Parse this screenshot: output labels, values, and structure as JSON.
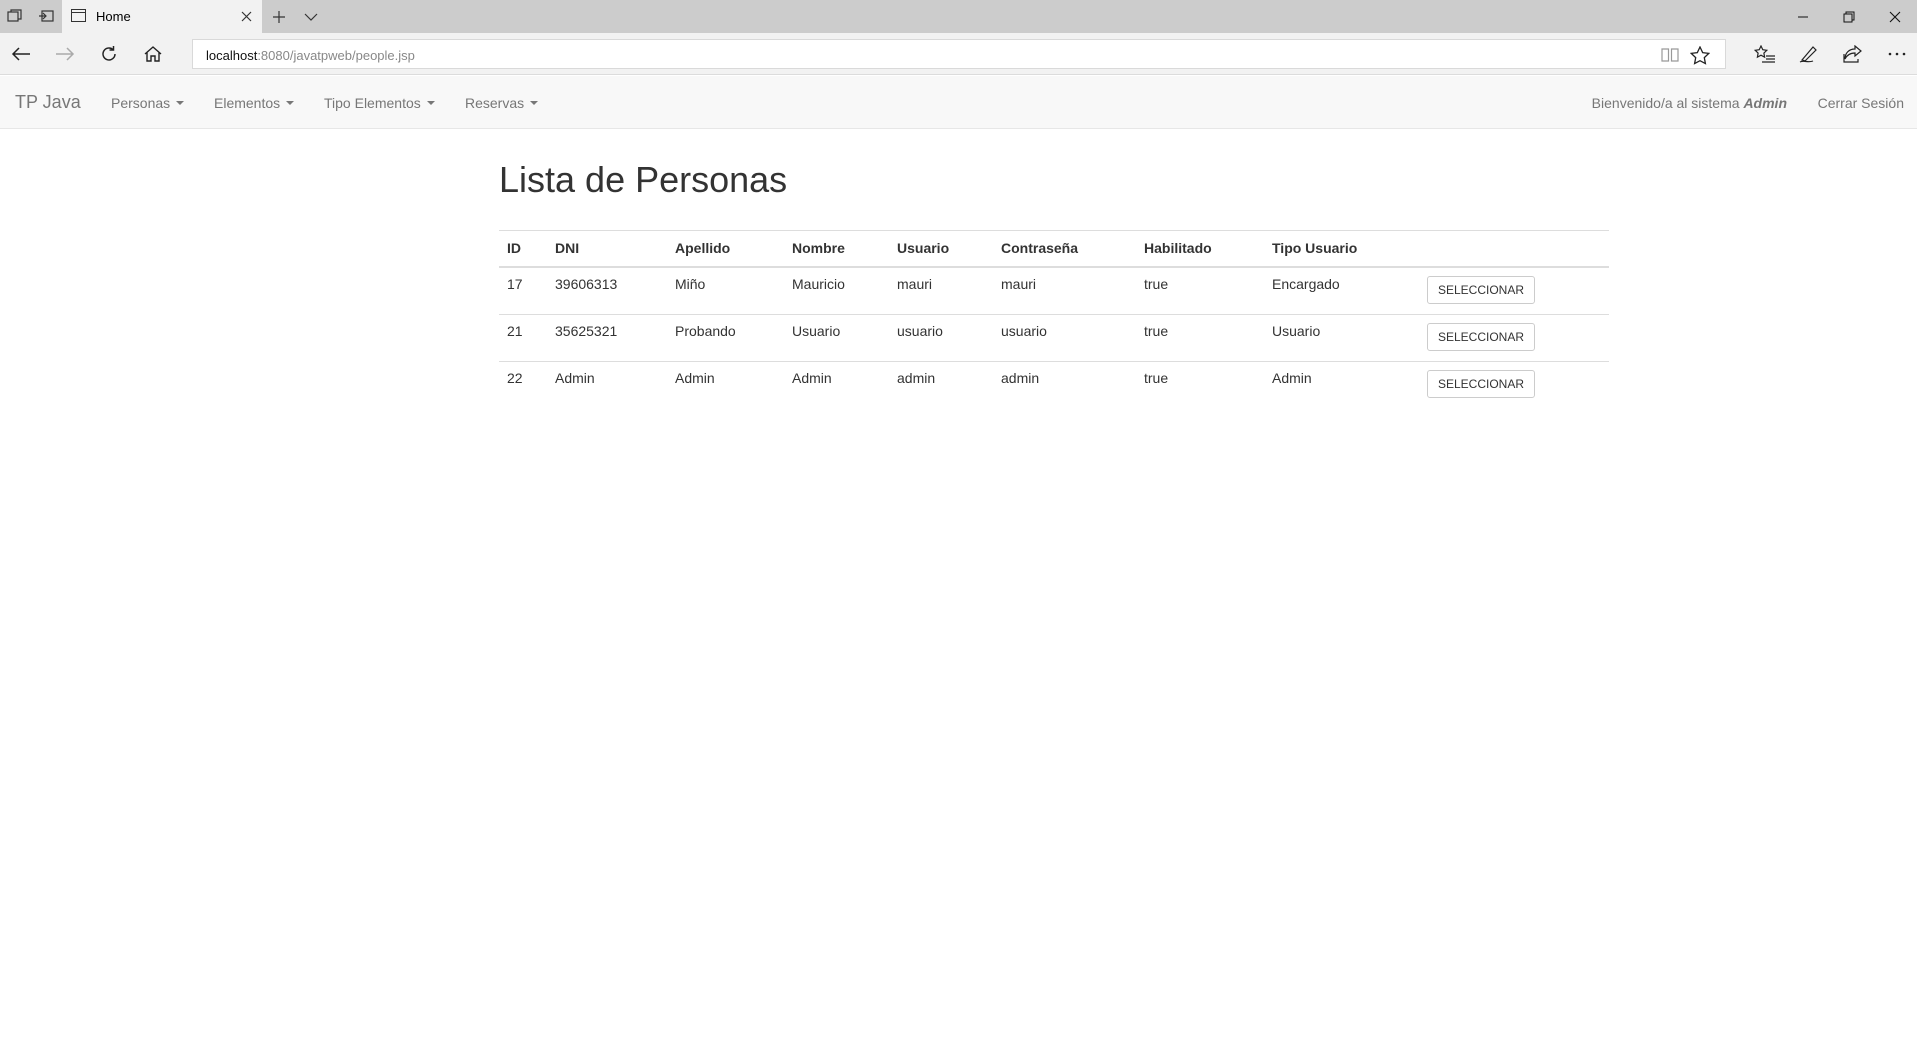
{
  "browser": {
    "tab_title": "Home",
    "url_host": "localhost",
    "url_path": ":8080/javatpweb/people.jsp"
  },
  "app": {
    "brand": "TP Java",
    "menus": [
      {
        "label": "Personas"
      },
      {
        "label": "Elementos"
      },
      {
        "label": "Tipo Elementos"
      },
      {
        "label": "Reservas"
      }
    ],
    "welcome_prefix": "Bienvenido/a al sistema",
    "welcome_user": "Admin",
    "logout_label": "Cerrar Sesión"
  },
  "main": {
    "title": "Lista de Personas",
    "table": {
      "headers": [
        "ID",
        "DNI",
        "Apellido",
        "Nombre",
        "Usuario",
        "Contraseña",
        "Habilitado",
        "Tipo Usuario",
        ""
      ],
      "rows": [
        {
          "id": "17",
          "dni": "39606313",
          "apellido": "Miño",
          "nombre": "Mauricio",
          "usuario": "mauri",
          "contrasena": "mauri",
          "habilitado": "true",
          "tipo": "Encargado",
          "action": "SELECCIONAR"
        },
        {
          "id": "21",
          "dni": "35625321",
          "apellido": "Probando",
          "nombre": "Usuario",
          "usuario": "usuario",
          "contrasena": "usuario",
          "habilitado": "true",
          "tipo": "Usuario",
          "action": "SELECCIONAR"
        },
        {
          "id": "22",
          "dni": "Admin",
          "apellido": "Admin",
          "nombre": "Admin",
          "usuario": "admin",
          "contrasena": "admin",
          "habilitado": "true",
          "tipo": "Admin",
          "action": "SELECCIONAR"
        }
      ]
    }
  }
}
